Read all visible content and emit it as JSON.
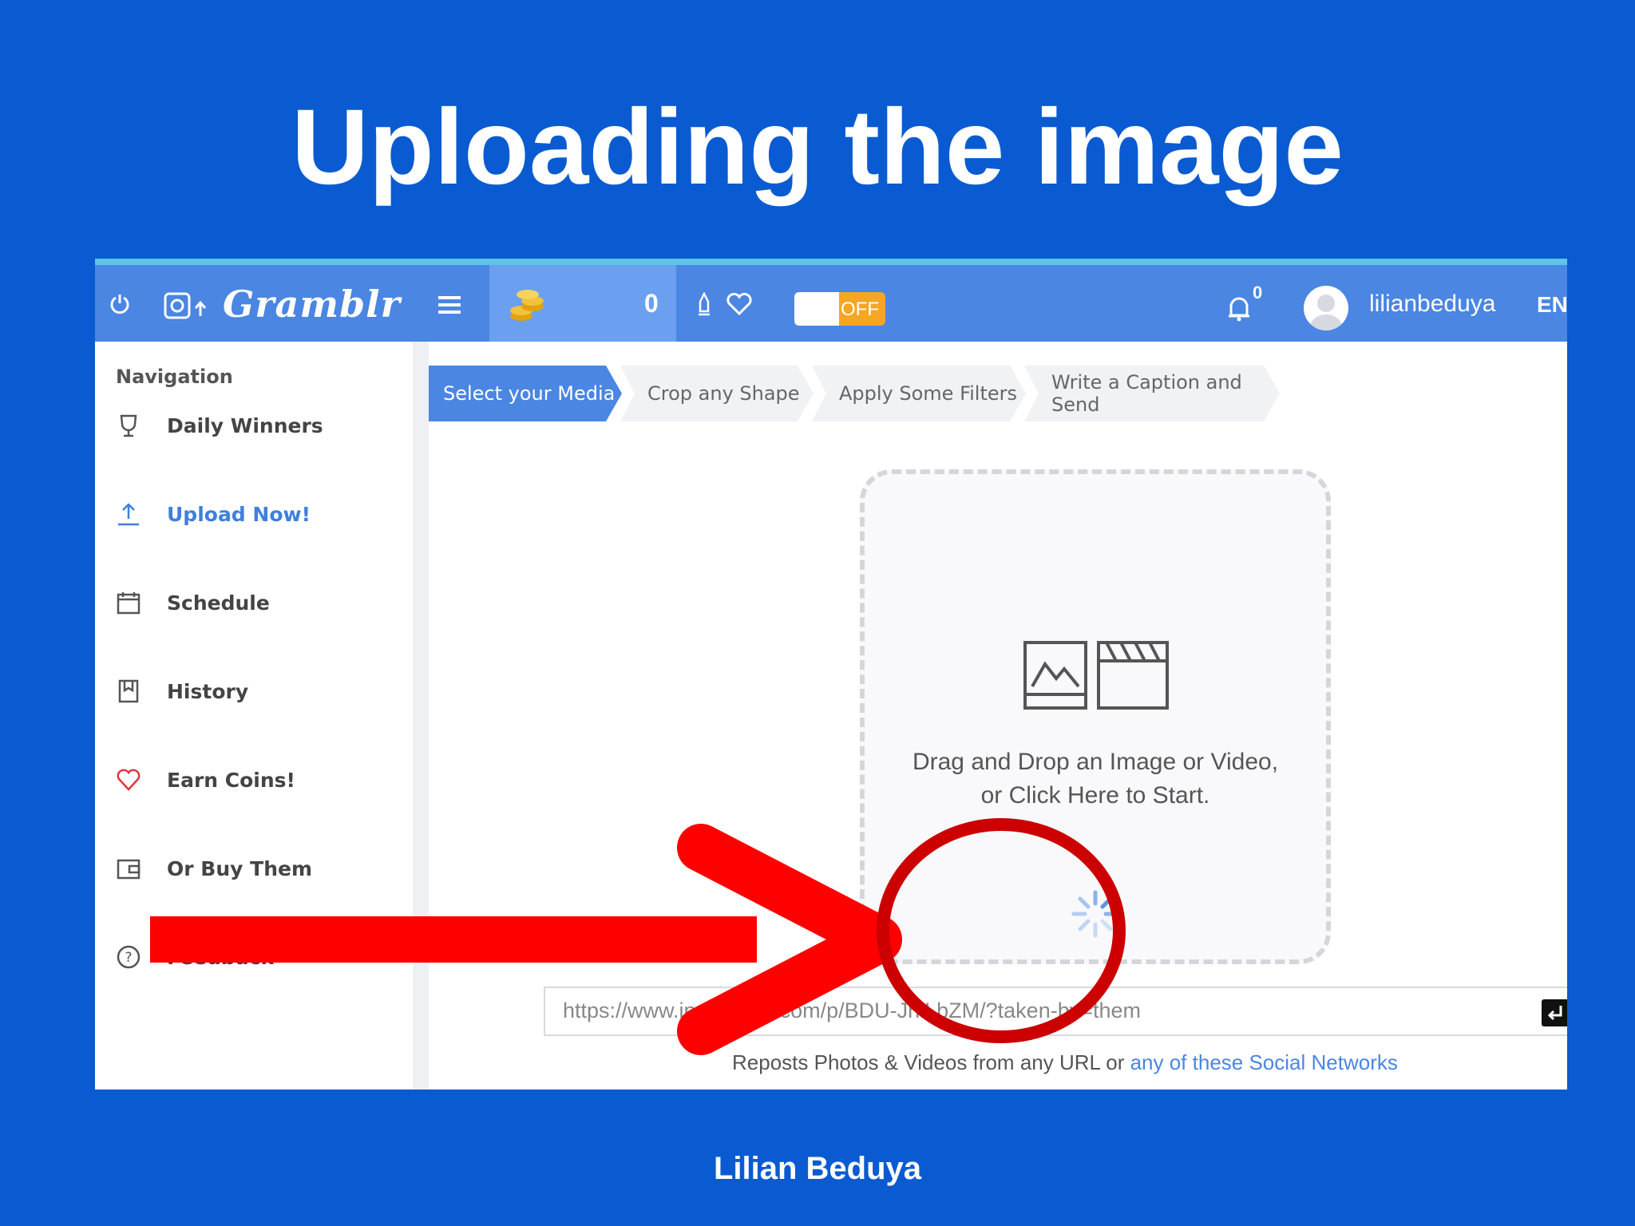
{
  "slide": {
    "title": "Uploading the image",
    "author": "Lilian Beduya"
  },
  "app": {
    "brand": "Gramblr",
    "coins": "0",
    "toggle": "OFF",
    "notifications": "0",
    "username": "lilianbeduya",
    "language": "EN"
  },
  "sidebar": {
    "heading": "Navigation",
    "items": [
      {
        "label": "Daily Winners",
        "icon": "trophy-icon"
      },
      {
        "label": "Upload Now!",
        "icon": "upload-icon"
      },
      {
        "label": "Schedule",
        "icon": "calendar-icon"
      },
      {
        "label": "History",
        "icon": "history-icon"
      },
      {
        "label": "Earn Coins!",
        "icon": "heart-icon"
      },
      {
        "label": "Or Buy Them",
        "icon": "wallet-icon"
      },
      {
        "label": "Feedback",
        "icon": "question-icon"
      }
    ]
  },
  "steps": [
    "Select your Media",
    "Crop any Shape",
    "Apply Some Filters",
    "Write a Caption and Send"
  ],
  "dropzone": {
    "line1": "Drag and Drop an Image or Video,",
    "line2": "or Click Here to Start."
  },
  "url": {
    "placeholder": "https://www.instagram.com/p/BDU-JnlLbZM/?taken-by=them",
    "hash": "#"
  },
  "reposts": {
    "text": "Reposts Photos & Videos from any URL or ",
    "link": "any of these Social Networks"
  },
  "colors": {
    "slide_bg": "#0a5bd1",
    "topbar": "#4a86e2",
    "accent": "#3f7fdc",
    "toggle": "#f6a623",
    "annotation": "#ff0000"
  }
}
